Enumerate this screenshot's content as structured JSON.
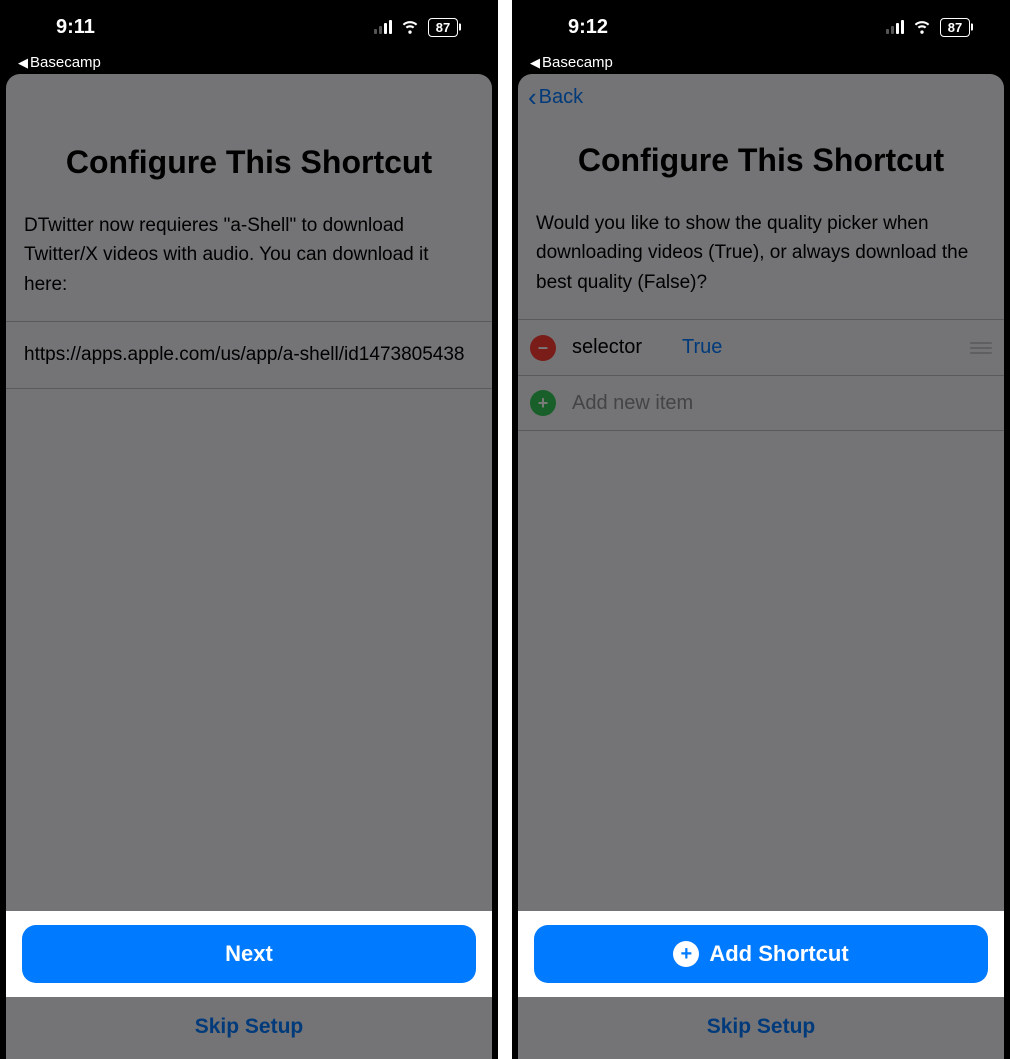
{
  "left": {
    "status": {
      "time": "9:11",
      "battery": "87",
      "breadcrumb": "Basecamp"
    },
    "title": "Configure This Shortcut",
    "body": "DTwitter now requieres \"a-Shell\" to download Twitter/X videos with audio. You can download it here:",
    "url": "https://apps.apple.com/us/app/a-shell/id1473805438",
    "primary_label": "Next",
    "skip_label": "Skip Setup"
  },
  "right": {
    "status": {
      "time": "9:12",
      "battery": "87",
      "breadcrumb": "Basecamp"
    },
    "back_label": "Back",
    "title": "Configure This Shortcut",
    "body": "Would you like to show the quality picker when downloading videos (True), or always download the best quality (False)?",
    "dict": {
      "key": "selector",
      "value": "True",
      "add_placeholder": "Add new item"
    },
    "primary_label": "Add Shortcut",
    "skip_label": "Skip Setup"
  }
}
